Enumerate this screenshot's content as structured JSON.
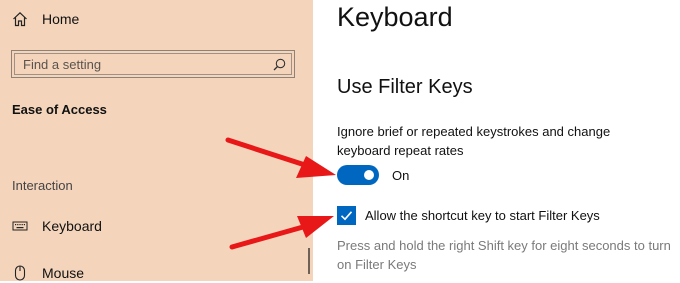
{
  "sidebar": {
    "home_label": "Home",
    "search_placeholder": "Find a setting",
    "section_title": "Ease of Access",
    "group_label": "Interaction",
    "items": [
      {
        "label": "Keyboard",
        "icon": "keyboard-icon"
      },
      {
        "label": "Mouse",
        "icon": "mouse-icon"
      }
    ]
  },
  "main": {
    "title": "Keyboard",
    "section": "Use Filter Keys",
    "description": "Ignore brief or repeated keystrokes and change keyboard repeat rates",
    "toggle": {
      "state_label": "On",
      "on": true
    },
    "checkbox": {
      "label": "Allow the shortcut key to start Filter Keys",
      "checked": true
    },
    "help_text": "Press and hold the right Shift key for eight seconds to turn on Filter Keys"
  },
  "colors": {
    "sidebar_bg": "#f4d5bc",
    "accent": "#0067c0",
    "annotation_arrow": "#e81818"
  }
}
